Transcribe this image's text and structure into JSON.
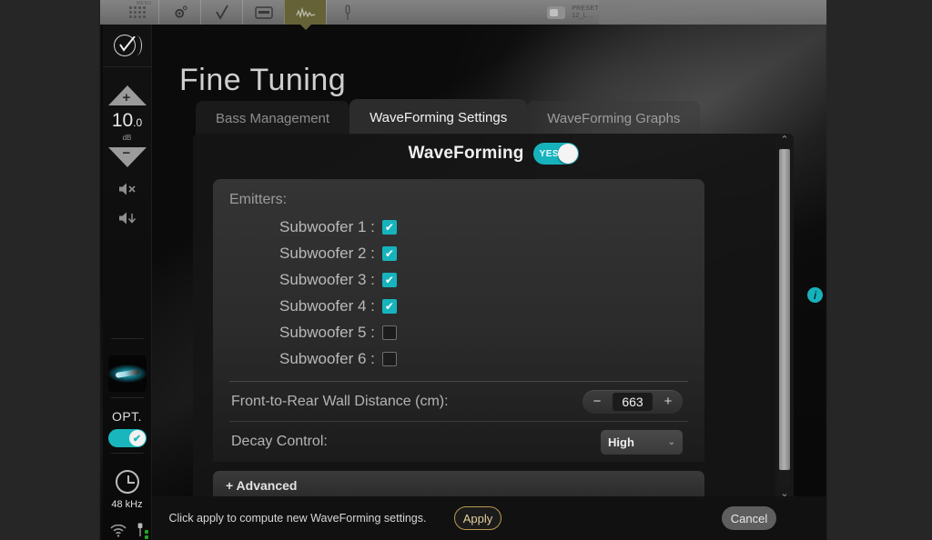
{
  "topbar": {
    "menu_label": "MENU",
    "items": [
      {
        "name": "grid-icon",
        "glyph": "grid"
      },
      {
        "name": "gear-icon",
        "glyph": "⚙"
      },
      {
        "name": "check-icon",
        "glyph": "✓"
      },
      {
        "name": "display-icon",
        "glyph": "▭"
      },
      {
        "name": "waveform-icon",
        "glyph": "∿"
      },
      {
        "name": "microphone-icon",
        "glyph": "❙"
      }
    ],
    "preset_label": "PRESET",
    "preset_value": "12_L..."
  },
  "rail": {
    "logo_name": "trinnov-logo",
    "volume_up": "+",
    "volume_down": "−",
    "gain_value": "10",
    "gain_decimal": ".0",
    "gain_unit": "dB",
    "mute_icon": "🔇",
    "dim_icon": "🔉",
    "source_label": "OPT.",
    "source_toggle_on": true,
    "source_toggle_check": "✔",
    "sample_rate": "48 kHz",
    "wifi_icon": "wifi",
    "usb_icon": "usb"
  },
  "page": {
    "title": "Fine Tuning"
  },
  "tabs": [
    {
      "label": "Bass Management",
      "active": false
    },
    {
      "label": "WaveForming Settings",
      "active": true
    },
    {
      "label": "WaveForming Graphs",
      "active": false
    }
  ],
  "dialog": {
    "title": "WaveForming",
    "toggle_label": "YES",
    "toggle_on": true,
    "emitters_label": "Emitters:",
    "emitters": [
      {
        "label": "Subwoofer 1 :",
        "checked": true
      },
      {
        "label": "Subwoofer 2 :",
        "checked": true
      },
      {
        "label": "Subwoofer 3 :",
        "checked": true
      },
      {
        "label": "Subwoofer 4 :",
        "checked": true
      },
      {
        "label": "Subwoofer 5 :",
        "checked": false
      },
      {
        "label": "Subwoofer 6 :",
        "checked": false
      }
    ],
    "wall_distance": {
      "label": "Front-to-Rear Wall Distance (cm):",
      "value": "663",
      "minus": "−",
      "plus": "+"
    },
    "decay_control": {
      "label": "Decay Control:",
      "value": "High",
      "chevron": "⌄"
    },
    "advanced_label": "+ Advanced",
    "scrollbar": {
      "up_arrow": "⌃",
      "down_arrow": "⌄"
    }
  },
  "footer": {
    "message": "Click apply to compute new WaveForming settings.",
    "apply_label": "Apply",
    "cancel_label": "Cancel"
  },
  "info_badge": {
    "glyph": "i"
  },
  "colors": {
    "accent_teal": "#17b3bd",
    "apply_gold": "#b99a4e",
    "active_tab_highlight": "#6d6a3c"
  }
}
